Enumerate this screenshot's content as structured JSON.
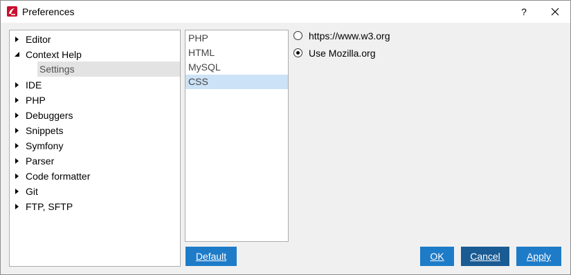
{
  "window": {
    "title": "Preferences",
    "help_label": "?",
    "icon": "app-logo-icon",
    "close_icon": "close-icon"
  },
  "tree": {
    "items": [
      {
        "label": "Editor",
        "state": "collapsed"
      },
      {
        "label": "Context Help",
        "state": "expanded"
      },
      {
        "label": "Settings",
        "state": "child-selected"
      },
      {
        "label": "IDE",
        "state": "collapsed"
      },
      {
        "label": "PHP",
        "state": "collapsed"
      },
      {
        "label": "Debuggers",
        "state": "collapsed"
      },
      {
        "label": "Snippets",
        "state": "collapsed"
      },
      {
        "label": "Symfony",
        "state": "collapsed"
      },
      {
        "label": "Parser",
        "state": "collapsed"
      },
      {
        "label": "Code formatter",
        "state": "collapsed"
      },
      {
        "label": "Git",
        "state": "collapsed"
      },
      {
        "label": "FTP, SFTP",
        "state": "collapsed"
      }
    ]
  },
  "languages": {
    "items": [
      "PHP",
      "HTML",
      "MySQL",
      "CSS"
    ],
    "selected": "CSS"
  },
  "options": {
    "choices": [
      {
        "label": "https://www.w3.org",
        "checked": false
      },
      {
        "label": "Use Mozilla.org",
        "checked": true
      }
    ]
  },
  "buttons": {
    "default": "Default",
    "ok": "OK",
    "cancel": "Cancel",
    "apply": "Apply"
  },
  "colors": {
    "accent": "#1e7bc8",
    "accent_dark": "#1a5b94",
    "selection": "#cce2f6"
  }
}
